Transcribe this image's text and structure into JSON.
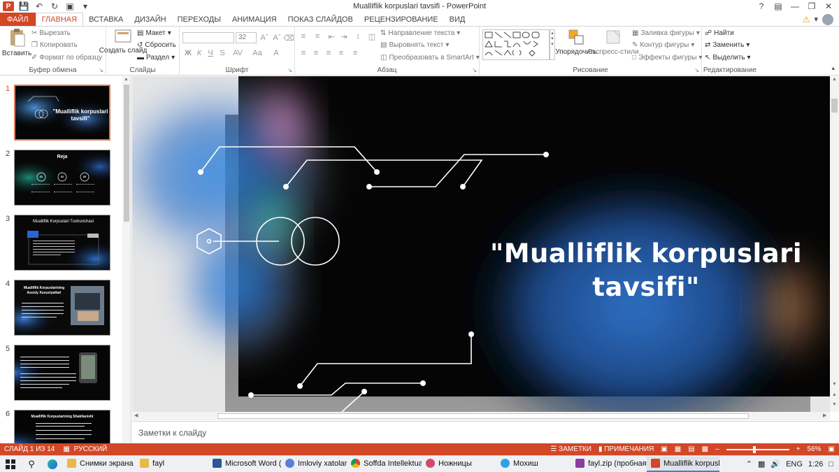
{
  "window": {
    "title": "Mualliflik korpuslari tavsifi - PowerPoint"
  },
  "tabs": [
    "ФАЙЛ",
    "ГЛАВНАЯ",
    "ВСТАВКА",
    "ДИЗАЙН",
    "ПЕРЕХОДЫ",
    "АНИМАЦИЯ",
    "ПОКАЗ СЛАЙДОВ",
    "РЕЦЕНЗИРОВАНИЕ",
    "ВИД"
  ],
  "ribbon": {
    "clipboard": {
      "label": "Буфер обмена",
      "paste": "Вставить",
      "cut": "Вырезать",
      "copy": "Копировать",
      "format_painter": "Формат по образцу"
    },
    "slides": {
      "label": "Слайды",
      "new_slide": "Создать слайд",
      "layout": "Макет",
      "reset": "Сбросить",
      "section": "Раздел"
    },
    "font": {
      "label": "Шрифт",
      "size": "32",
      "bold": "Ж",
      "italic": "К",
      "underline": "Ч",
      "strike": "S",
      "spacing": "AV",
      "case": "Aa",
      "color": "A"
    },
    "paragraph": {
      "label": "Абзац",
      "text_direction": "Направление текста",
      "align_text": "Выровнять текст",
      "smartart": "Преобразовать в SmartArt"
    },
    "drawing": {
      "label": "Рисование",
      "arrange": "Упорядочить",
      "quick_styles": "Экспресс-стили",
      "fill": "Заливка фигуры",
      "outline": "Контур фигуры",
      "effects": "Эффекты фигуры"
    },
    "editing": {
      "label": "Редактирование",
      "find": "Найти",
      "replace": "Заменить",
      "select": "Выделить"
    }
  },
  "slides": [
    {
      "num": "1",
      "title": "\"Mualliflik korpuslari tavsifi\"",
      "selected": true
    },
    {
      "num": "2",
      "title": "Reja"
    },
    {
      "num": "3",
      "title": "Mualliflik Korpuslari Tushunchasi"
    },
    {
      "num": "4",
      "title": "Mualliflik Korpuslarining Asosiy Xususiyatlari"
    },
    {
      "num": "5",
      "title": ""
    },
    {
      "num": "6",
      "title": "Mualliflik Korpuslarining Shakllanishi"
    }
  ],
  "slide2": {
    "b1": "01",
    "b2": "02",
    "b3": "03"
  },
  "current_slide": {
    "title": "\"Mualliflik korpuslari tavsifi\""
  },
  "notes": {
    "placeholder": "Заметки к слайду"
  },
  "status": {
    "slide_info": "СЛАЙД 1 ИЗ 14",
    "language": "РУССКИЙ",
    "notes_btn": "ЗАМЕТКИ",
    "comments_btn": "ПРИМЕЧАНИЯ",
    "zoom": "56%"
  },
  "taskbar": {
    "items": [
      {
        "label": "Снимки экрана",
        "color": "#e8b949"
      },
      {
        "label": "fayl",
        "color": "#e8b949"
      },
      {
        "label": "Microsoft Word (...",
        "color": "#2b579a"
      },
      {
        "label": "Imloviy xatolarni ...",
        "color": "#5a7fd8"
      },
      {
        "label": "Soffda Intellektua...",
        "color": "#db4437"
      },
      {
        "label": "Ножницы",
        "color": "#d34a6a"
      },
      {
        "label": "Мохиш",
        "color": "#2aa3e0"
      },
      {
        "label": "fayl.zip (пробная...",
        "color": "#8a3fa0"
      },
      {
        "label": "Mualliflik korpusl...",
        "color": "#d24726"
      }
    ],
    "lang": "ENG",
    "time": "1:26"
  },
  "colors": {
    "accent": "#d24726",
    "status_bar": "#d24726"
  }
}
